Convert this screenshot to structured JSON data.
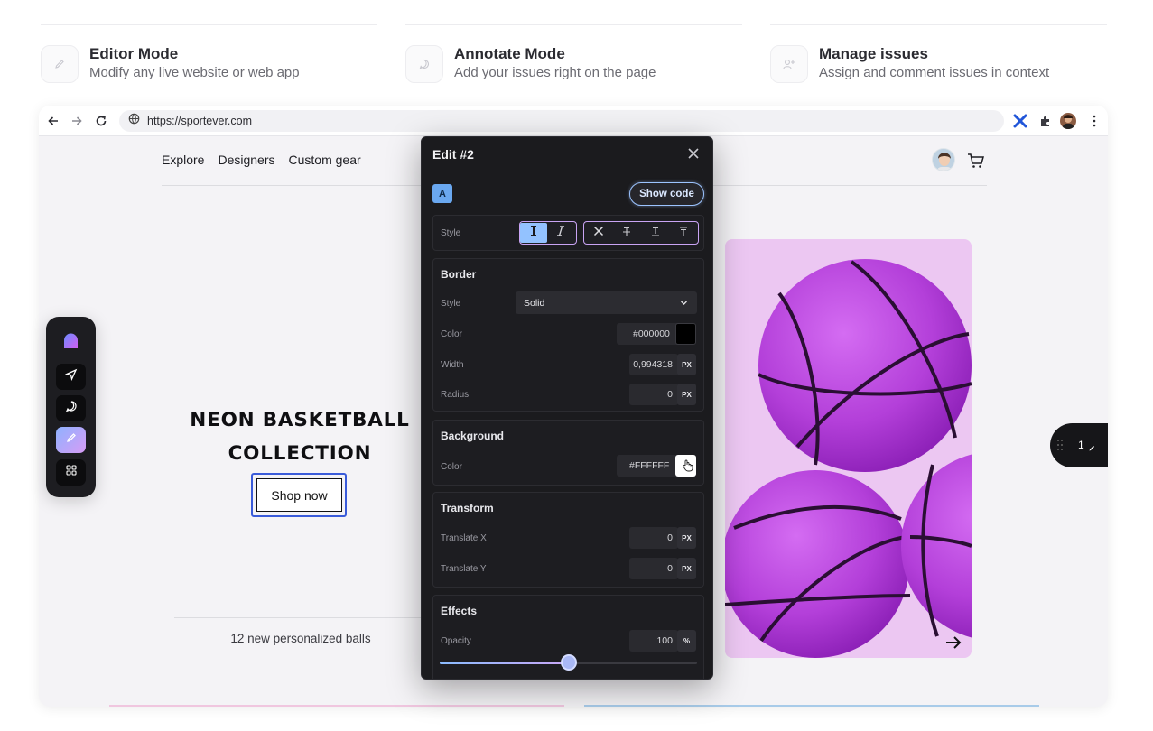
{
  "features": [
    {
      "title": "Editor Mode",
      "description": "Modify any live website or web app",
      "icon": "pencil-icon"
    },
    {
      "title": "Annotate Mode",
      "description": "Add your issues right on the page",
      "icon": "chat-bubble-icon"
    },
    {
      "title": "Manage issues",
      "description": "Assign and comment issues in context",
      "icon": "add-user-icon"
    }
  ],
  "browser": {
    "url": "https://sportever.com"
  },
  "site": {
    "nav": [
      "Explore",
      "Designers",
      "Custom gear"
    ],
    "hero_title_line1": "NEON BASKETBALL",
    "hero_title_line2": "COLLECTION",
    "shop_button": "Shop now",
    "subtitle": "12 new personalized balls"
  },
  "issues_pill": {
    "count": "1"
  },
  "panel": {
    "title": "Edit #2",
    "badge": "A",
    "show_code": "Show code",
    "style_label": "Style",
    "border": {
      "title": "Border",
      "style_label": "Style",
      "style_value": "Solid",
      "color_label": "Color",
      "color_value": "#000000",
      "width_label": "Width",
      "width_value": "0,994318",
      "width_unit": "PX",
      "radius_label": "Radius",
      "radius_value": "0",
      "radius_unit": "PX"
    },
    "background": {
      "title": "Background",
      "color_label": "Color",
      "color_value": "#FFFFFF"
    },
    "transform": {
      "title": "Transform",
      "tx_label": "Translate X",
      "tx_value": "0",
      "tx_unit": "PX",
      "ty_label": "Translate Y",
      "ty_value": "0",
      "ty_unit": "PX"
    },
    "effects": {
      "title": "Effects",
      "opacity_label": "Opacity",
      "opacity_value": "100",
      "opacity_unit": "%",
      "opacity_fraction": 0.5
    }
  },
  "colors": {
    "accent_blue": "#93c2ff",
    "accent_purple": "#c9a4f4",
    "ball_purple": "#b33fd9",
    "photo_bg": "#ecc7f2",
    "selection_outline": "#3a5bd9"
  }
}
